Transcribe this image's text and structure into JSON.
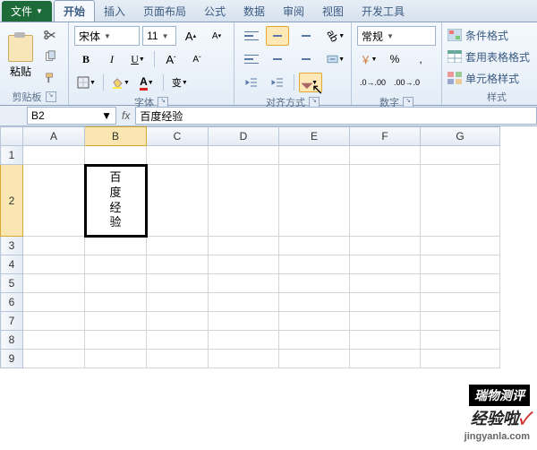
{
  "tabs": {
    "file": "文件",
    "home": "开始",
    "insert": "插入",
    "layout": "页面布局",
    "formula": "公式",
    "data": "数据",
    "review": "审阅",
    "view": "视图",
    "dev": "开发工具"
  },
  "clipboard": {
    "paste": "粘贴",
    "label": "剪贴板"
  },
  "font": {
    "name": "宋体",
    "size": "11",
    "btn_bold": "B",
    "btn_ital": "I",
    "btn_und": "U",
    "btn_a_big": "A",
    "btn_a_small": "A",
    "btn_a_color": "A",
    "label": "字体",
    "wen": "变"
  },
  "align": {
    "label": "对齐方式",
    "wrap": "自动换行",
    "merge": "合并后居中"
  },
  "number": {
    "fmt": "常规",
    "label": "数字",
    "pct": "%",
    "comma": ",",
    "dec_inc": ".0",
    "dec_dec": ".00"
  },
  "styles": {
    "cond": "条件格式",
    "tbl": "套用表格格式",
    "cell": "单元格样式",
    "label": "样式"
  },
  "namebox": "B2",
  "formula_val": "百度经验",
  "cols": [
    "A",
    "B",
    "C",
    "D",
    "E",
    "F",
    "G"
  ],
  "rows": [
    "1",
    "2",
    "3",
    "4",
    "5",
    "6",
    "7",
    "8",
    "9"
  ],
  "cell_b2": {
    "c1": "百",
    "c2": "度",
    "c3": "经",
    "c4": "验"
  },
  "watermark": {
    "l1": "瑞物测评",
    "l2": "经验啦",
    "l3": "jingyanla.com",
    "chk": "✓"
  }
}
